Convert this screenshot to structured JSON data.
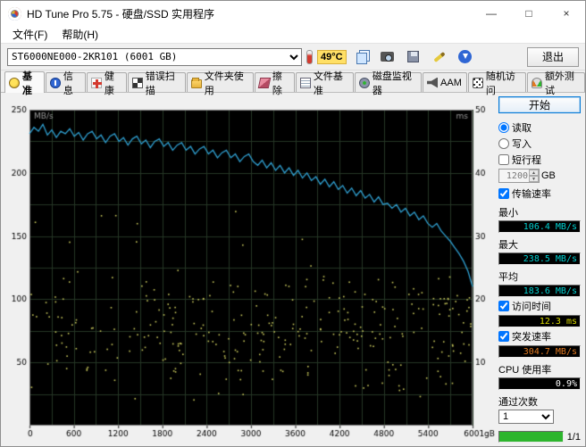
{
  "window": {
    "title": "HD Tune Pro 5.75 - 硬盘/SSD 实用程序",
    "controls": {
      "minimize": "—",
      "maximize": "□",
      "close": "×"
    }
  },
  "menu": {
    "file": "文件(F)",
    "help": "帮助(H)"
  },
  "toolbar": {
    "drive": "ST6000NE000-2KR101 (6001 GB)",
    "temperature": "49°C",
    "exit_label": "退出"
  },
  "tabs": [
    {
      "id": "benchmark",
      "label": "基准",
      "icon": "benchmark-icon",
      "active": true
    },
    {
      "id": "info",
      "label": "信息",
      "icon": "info-icon",
      "active": false
    },
    {
      "id": "health",
      "label": "健康",
      "icon": "health-icon",
      "active": false
    },
    {
      "id": "error-scan",
      "label": "错误扫描",
      "icon": "error-scan-icon",
      "active": false
    },
    {
      "id": "folder-usage",
      "label": "文件夹使用",
      "icon": "folder-usage-icon",
      "active": false
    },
    {
      "id": "erase",
      "label": "擦除",
      "icon": "erase-icon",
      "active": false
    },
    {
      "id": "file-benchmark",
      "label": "文件基准",
      "icon": "file-benchmark-icon",
      "active": false
    },
    {
      "id": "disk-monitor",
      "label": "磁盘监视器",
      "icon": "disk-monitor-icon",
      "active": false
    },
    {
      "id": "aam",
      "label": "AAM",
      "icon": "aam-icon",
      "active": false
    },
    {
      "id": "random-access",
      "label": "随机访问",
      "icon": "random-access-icon",
      "active": false
    },
    {
      "id": "extra-tests",
      "label": "额外测试",
      "icon": "extra-tests-icon",
      "active": false
    }
  ],
  "sidebar": {
    "start_label": "开始",
    "read_label": "读取",
    "read_checked": true,
    "write_label": "写入",
    "short_stroke_label": "短行程",
    "short_stroke_value": "1200",
    "short_stroke_unit": "GB",
    "transfer_label": "传输速率",
    "transfer_checked": true,
    "min_label": "最小",
    "min_value": "106.4 MB/s",
    "max_label": "最大",
    "max_value": "238.5 MB/s",
    "avg_label": "平均",
    "avg_value": "183.6 MB/s",
    "access_label": "访问时间",
    "access_checked": true,
    "access_value": "12.3 ms",
    "burst_label": "突发速率",
    "burst_checked": true,
    "burst_value": "304.7 MB/s",
    "cpu_label": "CPU 使用率",
    "cpu_value": "0.9%",
    "pass_label": "通过次数",
    "pass_value": "1",
    "progress_text": "1/1"
  },
  "colors": {
    "accent": "#0078d7",
    "progress_green": "#2db52d",
    "values": {
      "min-value": "#00d0d0",
      "max-value": "#00d0d0",
      "avg-value": "#00d0d0",
      "access-value": "#d8d800",
      "burst-value": "#e07820",
      "cpu-value": "#ffffff"
    }
  },
  "chart_data": {
    "type": "line",
    "title": "HD Tune benchmark transfer rate with access time scatter",
    "x_max_gb": 6001,
    "x_ticks": [
      "0",
      "600",
      "1200",
      "1800",
      "2400",
      "3000",
      "3600",
      "4200",
      "4800",
      "5400",
      "6001gB"
    ],
    "y_left_label": "MB/s",
    "y_left_ticks": [
      250,
      200,
      150,
      100,
      50
    ],
    "y_left_max": 250,
    "y_right_label": "ms",
    "y_right_ticks": [
      50,
      40,
      30,
      20,
      10
    ],
    "y_right_max": 50,
    "background": "#000000",
    "border_color": "#777777",
    "grid": {
      "color": "#263726",
      "x_step_gb": 300,
      "y_step_mbps": 25
    },
    "series": [
      {
        "name": "transfer-rate",
        "unit": "MB/s",
        "color": "#2f9fd0",
        "min": 106.4,
        "max": 238.5,
        "avg": 183.6,
        "values": [
          231,
          236,
          233,
          238.5,
          230,
          234,
          228,
          233,
          231,
          235,
          229,
          232,
          226,
          231,
          233,
          227,
          230,
          224,
          229,
          231,
          225,
          228,
          222,
          227,
          229,
          223,
          226,
          220,
          225,
          227,
          221,
          224,
          218,
          222,
          224,
          218,
          221,
          215,
          219,
          221,
          215,
          218,
          212,
          216,
          218,
          212,
          215,
          209,
          213,
          215,
          209,
          206,
          210,
          204,
          208,
          202,
          206,
          200,
          204,
          198,
          202,
          196,
          200,
          194,
          197,
          191,
          195,
          189,
          193,
          187,
          190,
          184,
          188,
          182,
          186,
          180,
          183,
          177,
          181,
          175,
          176,
          172,
          175,
          169,
          172,
          166,
          169,
          163,
          166,
          160,
          157,
          160,
          154,
          150,
          146,
          141,
          136,
          130,
          122,
          110
        ]
      }
    ],
    "scatter": {
      "name": "access-time",
      "unit": "ms",
      "color": "#c9c95c",
      "avg_ms": 12.3,
      "count": 320,
      "ms_min": 4,
      "ms_max": 26,
      "seed": 7
    }
  }
}
